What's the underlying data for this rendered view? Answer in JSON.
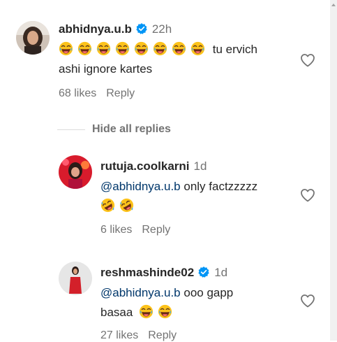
{
  "comments": [
    {
      "username": "abhidnya.u.b",
      "time": "22h",
      "text": "tu ervich ashi ignore kartes",
      "text_line1": "tu ervich",
      "text_line2": "ashi ignore kartes",
      "emojis": [
        "laughing-emoji",
        "laughing-emoji",
        "laughing-emoji",
        "laughing-emoji",
        "laughing-emoji",
        "laughing-emoji",
        "laughing-emoji",
        "laughing-emoji"
      ],
      "likes": "68 likes",
      "reply_label": "Reply"
    }
  ],
  "hide_replies_label": "Hide all replies",
  "replies": [
    {
      "username": "rutuja.coolkarni",
      "time": "1d",
      "mention": "@abhidnya.u.b",
      "text": "only factzzzzz",
      "emojis": [
        "rofl-emoji",
        "rofl-emoji"
      ],
      "likes": "6 likes",
      "reply_label": "Reply"
    },
    {
      "username": "reshmashinde02",
      "time": "1d",
      "mention": "@abhidnya.u.b",
      "text_line1": "ooo gapp",
      "text_line2": "basaa",
      "emojis": [
        "laughing-emoji",
        "laughing-emoji"
      ],
      "likes": "27 likes",
      "reply_label": "Reply"
    }
  ],
  "colors": {
    "text": "#262626",
    "secondary": "#737373",
    "mention": "#00376b",
    "verified": "#0095f6"
  }
}
